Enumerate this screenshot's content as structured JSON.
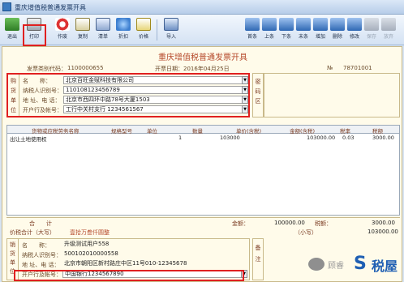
{
  "window": {
    "title": "重庆增值税普通发票开具"
  },
  "toolbar": {
    "left": [
      {
        "label": "退出",
        "icon": "exit-icon"
      },
      {
        "label": "打印",
        "icon": "printer-icon"
      },
      {
        "label": "作废",
        "icon": "void-icon"
      },
      {
        "label": "复制",
        "icon": "copy-icon"
      },
      {
        "label": "清单",
        "icon": "list-icon"
      },
      {
        "label": "折扣",
        "icon": "discount-icon"
      },
      {
        "label": "价格",
        "icon": "price-icon"
      },
      {
        "label": "导入",
        "icon": "import-icon"
      }
    ],
    "right": [
      {
        "label": "首条",
        "icon": "first-icon",
        "disabled": false
      },
      {
        "label": "上条",
        "icon": "prev-icon",
        "disabled": false
      },
      {
        "label": "下条",
        "icon": "next-icon",
        "disabled": false
      },
      {
        "label": "末条",
        "icon": "last-icon",
        "disabled": false
      },
      {
        "label": "增加",
        "icon": "add-icon",
        "disabled": false
      },
      {
        "label": "删除",
        "icon": "delete-icon",
        "disabled": false
      },
      {
        "label": "修改",
        "icon": "edit-icon",
        "disabled": false
      },
      {
        "label": "保存",
        "icon": "save-icon",
        "disabled": true
      },
      {
        "label": "放弃",
        "icon": "cancel-icon",
        "disabled": true
      }
    ]
  },
  "invoice": {
    "title": "重庆增值税普通发票开具",
    "code_label": "发票类别代码：",
    "code_value": "1100000655",
    "date_label": "开票日期：",
    "date_value": "2016年04月25日",
    "no_label": "№",
    "no_value": "78701001"
  },
  "buyer": {
    "side_label": "购货单位",
    "fields": [
      {
        "label": "名　　称：",
        "value": "北京百旺金赋科技有限公司"
      },
      {
        "label": "纳税人识别号：",
        "value": "110108123456789"
      },
      {
        "label": "地 址、电 话：",
        "value": "北京市西四环中路78号大厦1503"
      },
      {
        "label": "开户行及帐号：",
        "value": "工行中关村支行  1234561567"
      }
    ]
  },
  "password_area": {
    "label": "密码区"
  },
  "grid": {
    "headers": [
      "货物或应税劳务名称",
      "规格型号",
      "单位",
      "数量",
      "单价(含税)",
      "金额(含税)",
      "税率",
      "税额"
    ],
    "rows": [
      [
        "出让土地使用权",
        "",
        "",
        "1",
        "103000",
        "103000.00",
        "0.03",
        "3000.00"
      ]
    ]
  },
  "totals": {
    "sum_label": "合　　计",
    "amount_label": "金额：",
    "amount_value": "100000.00",
    "tax_label": "税额：",
    "tax_value": "3000.00",
    "capital_label": "价税合计（大写）",
    "capital_value": "壹拾万叁仟圆整",
    "small_label": "（小写）",
    "small_value": "103000.00"
  },
  "seller": {
    "side_label": "销货单位",
    "fields": [
      {
        "label": "名　　称：",
        "value": "升级测试用户558"
      },
      {
        "label": "纳税人识别号：",
        "value": "500102010000558"
      },
      {
        "label": "地 址、电 话：",
        "value": "北京市朝阳区新村路庄中区11号010-12345678"
      },
      {
        "label": "开户行及帐号：",
        "value": "中国银行1234567890"
      }
    ],
    "remark_label": "备注"
  },
  "watermark": {
    "text1": "顾睿",
    "text2": "税屋",
    "glyph": "S"
  }
}
